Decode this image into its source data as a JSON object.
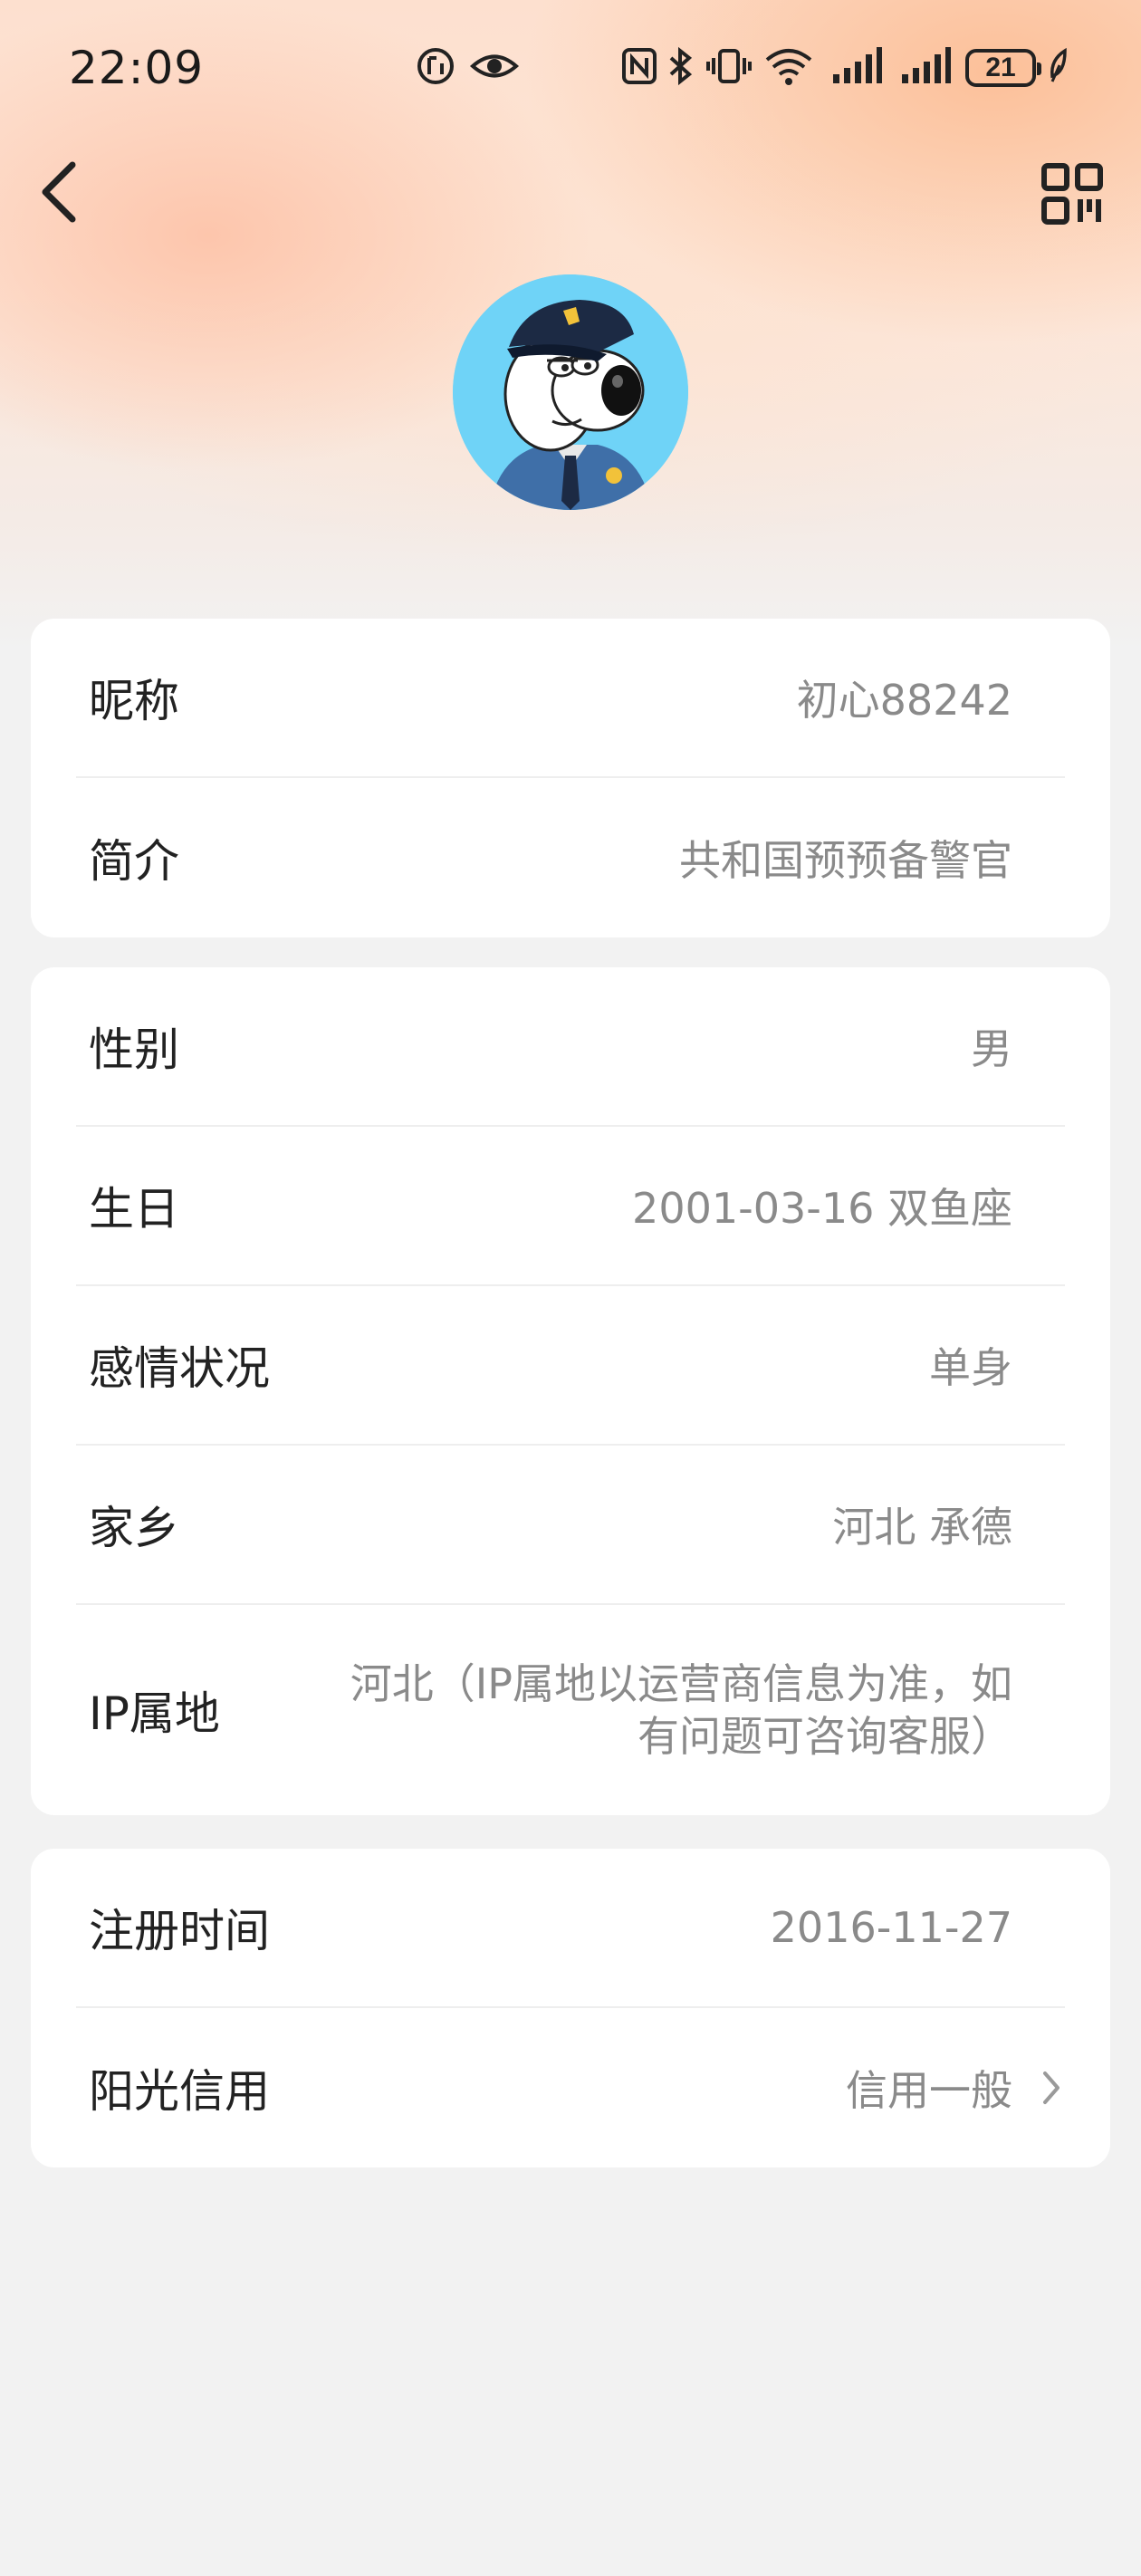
{
  "status_bar": {
    "time": "22:09",
    "battery_level": "21",
    "icons": [
      "data-saver-icon",
      "eye-icon",
      "nfc-icon",
      "bluetooth-icon",
      "vibrate-icon",
      "wifi-icon",
      "signal-icon-1",
      "signal-icon-2",
      "battery-icon",
      "leaf-icon"
    ]
  },
  "header": {
    "back_icon": "chevron-left-icon",
    "qr_icon": "qr-code-icon"
  },
  "profile": {
    "avatar": "avatar-police-dog"
  },
  "section_basic": {
    "rows": [
      {
        "label": "昵称",
        "value": "初心88242"
      },
      {
        "label": "简介",
        "value": "共和国预预备警官"
      }
    ]
  },
  "section_personal": {
    "rows": [
      {
        "label": "性别",
        "value": "男"
      },
      {
        "label": "生日",
        "value": "2001-03-16 双鱼座"
      },
      {
        "label": "感情状况",
        "value": "单身"
      },
      {
        "label": "家乡",
        "value": "河北 承德"
      },
      {
        "label": "IP属地",
        "value_line1": "河北（IP属地以运营商信息为准，如",
        "value_line2": "有问题可咨询客服）"
      }
    ]
  },
  "section_account": {
    "rows": [
      {
        "label": "注册时间",
        "value": "2016-11-27"
      },
      {
        "label": "阳光信用",
        "value": "信用一般",
        "icon": "chevron-right-icon"
      }
    ]
  },
  "colors": {
    "background": "#f2f2f2",
    "card": "#ffffff",
    "label_text": "#222222",
    "value_text": "#8a8a8a",
    "avatar_bg": "#6fd3f7"
  }
}
